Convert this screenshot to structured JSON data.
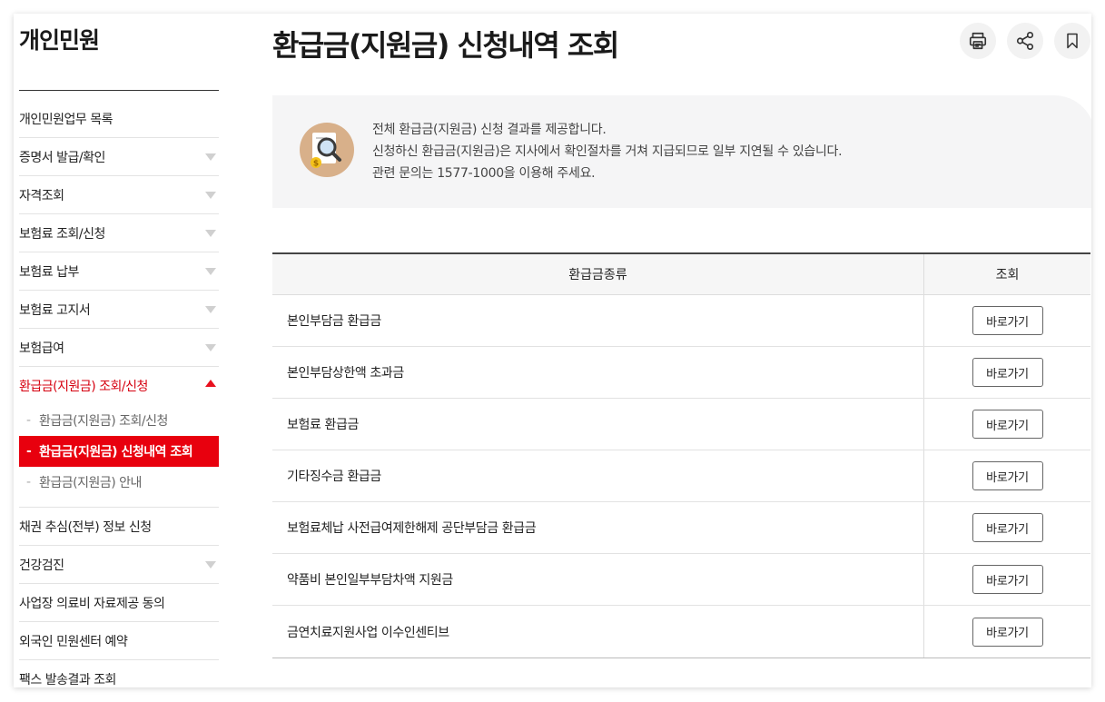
{
  "sidebar": {
    "title": "개인민원",
    "items": [
      {
        "label": "개인민원업무 목록",
        "caret": false
      },
      {
        "label": "증명서 발급/확인",
        "caret": true
      },
      {
        "label": "자격조회",
        "caret": true
      },
      {
        "label": "보험료 조회/신청",
        "caret": true
      },
      {
        "label": "보험료 납부",
        "caret": true
      },
      {
        "label": "보험료 고지서",
        "caret": true
      },
      {
        "label": "보험급여",
        "caret": true
      },
      {
        "label": "환급금(지원금) 조회/신청",
        "caret": true,
        "active": true
      },
      {
        "label": "채권 추심(전부) 정보 신청",
        "caret": false
      },
      {
        "label": "건강검진",
        "caret": true
      },
      {
        "label": "사업장 의료비 자료제공 동의",
        "caret": false
      },
      {
        "label": "외국인 민원센터 예약",
        "caret": false
      },
      {
        "label": "팩스 발송결과 조회",
        "caret": false
      }
    ],
    "submenu": [
      {
        "label": "환급금(지원금) 조회/신청"
      },
      {
        "label": "환급금(지원금) 신청내역 조회",
        "current": true
      },
      {
        "label": "환급금(지원금) 안내"
      }
    ]
  },
  "header": {
    "title": "환급금(지원금) 신청내역 조회",
    "icons": [
      "print-icon",
      "share-icon",
      "bookmark-icon"
    ]
  },
  "info": {
    "lines": [
      "전체 환급금(지원금) 신청 결과를 제공합니다.",
      "신청하신 환급금(지원금)은 지사에서 확인절차를 거쳐 지급되므로 일부 지연될 수 있습니다.",
      "관련 문의는 1577-1000을 이용해 주세요."
    ]
  },
  "table": {
    "headers": [
      "환급금종류",
      "조회"
    ],
    "button_label": "바로가기",
    "rows": [
      "본인부담금 환급금",
      "본인부담상한액 초과금",
      "보험료 환급금",
      "기타징수금 환급금",
      "보험료체납 사전급여제한해제 공단부담금 환급금",
      "약품비 본인일부부담차액 지원금",
      "금연치료지원사업 이수인센티브"
    ]
  },
  "colors": {
    "accent": "#e8000e",
    "active_text": "#d6000f",
    "info_bg": "#f5f5f6",
    "icon_circle": "#d8b08a"
  }
}
